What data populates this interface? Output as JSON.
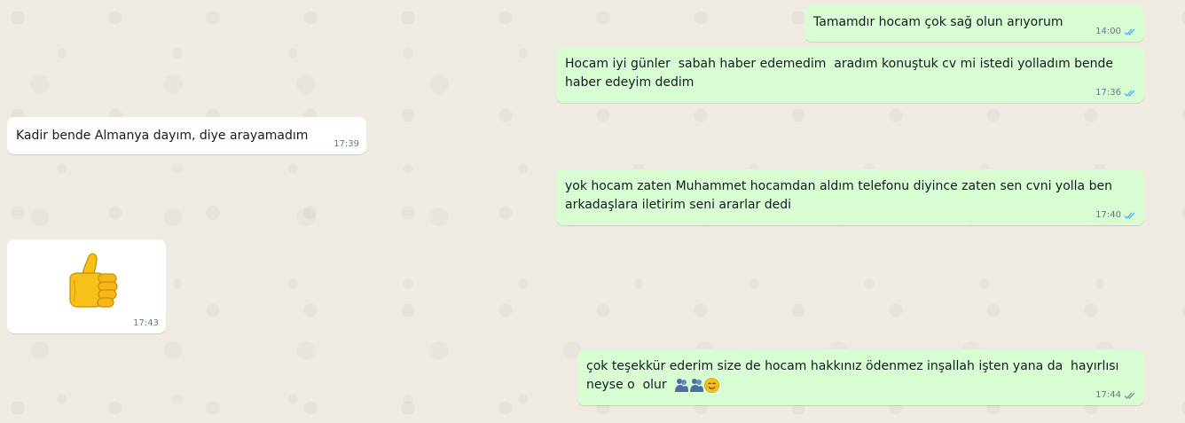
{
  "colors": {
    "outgoing_bubble": "#d9fdd3",
    "incoming_bubble": "#ffffff",
    "wallpaper": "#efeae2",
    "read_tick": "#53bdeb",
    "delivered_tick": "#8696a0",
    "timestamp": "#667781"
  },
  "messages": [
    {
      "direction": "outgoing",
      "text": "Tamamdır hocam çok sağ olun arıyorum",
      "time": "14:00",
      "status": "read"
    },
    {
      "direction": "outgoing",
      "text": "Hocam iyi günler  sabah haber edemedim  aradım konuştuk cv mi istedi yolladım bende haber edeyim dedim",
      "time": "17:36",
      "status": "read"
    },
    {
      "direction": "incoming",
      "text": "Kadir bende Almanya dayım, diye arayamadım",
      "time": "17:39"
    },
    {
      "direction": "outgoing",
      "text": "yok hocam zaten Muhammet hocamdan aldım telefonu diyince zaten sen cvni yolla ben arkadaşlara iletirim seni ararlar dedi",
      "time": "17:40",
      "status": "read"
    },
    {
      "direction": "incoming",
      "emoji": "thumbs-up",
      "time": "17:43"
    },
    {
      "direction": "outgoing",
      "text": "çok teşekkür ederim size de hocam hakkınız ödenmez inşallah işten yana da  hayırlısı neyse o  olur",
      "emojis": [
        "people-hugging",
        "people-hugging",
        "smiling-face-with-smiling-eyes"
      ],
      "time": "17:44",
      "status": "delivered"
    }
  ]
}
